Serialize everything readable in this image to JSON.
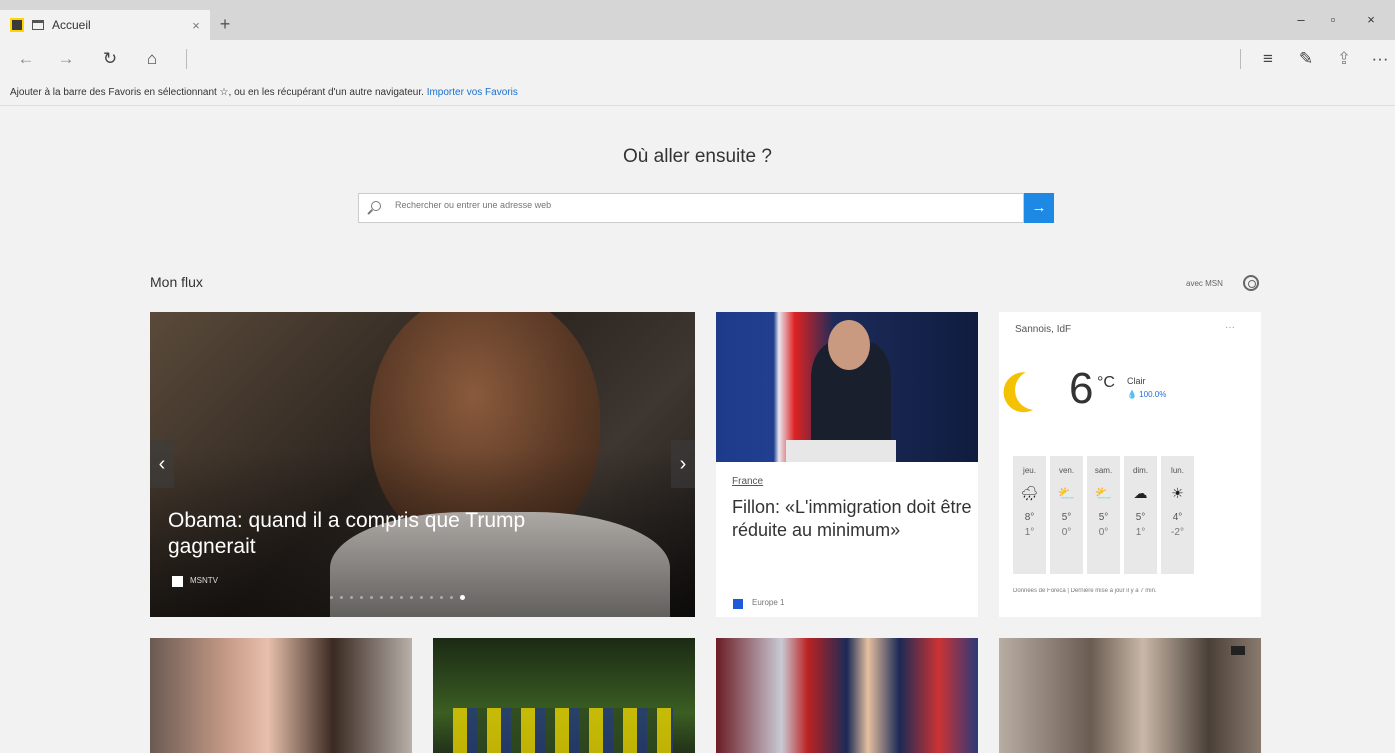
{
  "tab": {
    "title": "Accueil",
    "close": "×",
    "new": "+"
  },
  "window": {
    "minimize": "–",
    "maximize": "▫",
    "close": "×"
  },
  "nav": {
    "back": "←",
    "forward": "→",
    "refresh": "↻",
    "home": "⌂",
    "hub": "≡",
    "note": "✎",
    "share": "⇪",
    "more": "···"
  },
  "favbar": {
    "text": "Ajouter à la barre des Favoris en sélectionnant ☆, ou en les récupérant d'un autre navigateur.",
    "link": "Importer vos Favoris"
  },
  "start": {
    "heading": "Où aller ensuite ?",
    "search_placeholder": "Rechercher ou entrer une adresse web",
    "go": "→"
  },
  "feed": {
    "title": "Mon flux",
    "provider": "avec MSN"
  },
  "hero": {
    "title": "Obama: quand il a compris que Trump gagnerait",
    "source": "MSNTV",
    "prev": "‹",
    "next": "›",
    "dots": 14,
    "active_dot": 13
  },
  "article": {
    "category": "France",
    "title": "Fillon: «L'immigration doit être réduite au minimum»",
    "source": "Europe 1",
    "source_icon_color": "#1e5bd6"
  },
  "weather": {
    "location": "Sannois, IdF",
    "more": "···",
    "temp": "6",
    "unit": "°C",
    "condition": "Clair",
    "humidity": "💧 100.0%",
    "days": [
      {
        "name": "jeu.",
        "icon": "🌧",
        "hi": "8°",
        "lo": "1°"
      },
      {
        "name": "ven.",
        "icon": "⛅",
        "hi": "5°",
        "lo": "0°"
      },
      {
        "name": "sam.",
        "icon": "⛅",
        "hi": "5°",
        "lo": "0°"
      },
      {
        "name": "dim.",
        "icon": "☁",
        "hi": "5°",
        "lo": "1°"
      },
      {
        "name": "lun.",
        "icon": "☀",
        "hi": "4°",
        "lo": "-2°"
      }
    ],
    "footer": "Données de Foreca | Dernière mise à jour il y a 7 min."
  },
  "colors": {
    "accent": "#1e88e5",
    "link": "#1a6fcf",
    "sun": "#f4c200"
  }
}
